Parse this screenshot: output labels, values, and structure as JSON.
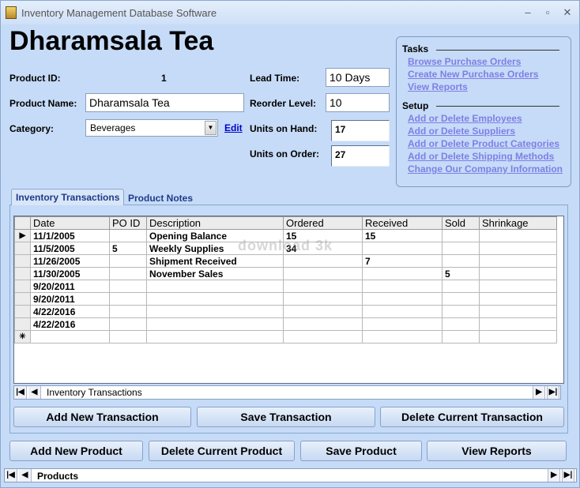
{
  "window": {
    "title": "Inventory Management Database Software",
    "minimize": "–",
    "maximize": "▫",
    "close": "✕"
  },
  "product": {
    "name_heading": "Dharamsala Tea",
    "id_label": "Product ID:",
    "id_value": "1",
    "name_label": "Product Name:",
    "name_value": "Dharamsala Tea",
    "category_label": "Category:",
    "category_value": "Beverages",
    "edit_link": "Edit",
    "lead_time_label": "Lead Time:",
    "lead_time_value": "10 Days",
    "reorder_label": "Reorder Level:",
    "reorder_value": "10",
    "on_hand_label": "Units on Hand:",
    "on_hand_value": "17",
    "on_order_label": "Units on Order:",
    "on_order_value": "27"
  },
  "tasks": {
    "heading": "Tasks",
    "links": [
      "Browse Purchase Orders",
      "Create New Purchase Orders",
      "View Reports"
    ],
    "setup_heading": "Setup",
    "setup_links": [
      "Add or Delete Employees",
      "Add or Delete Suppliers",
      "Add or Delete Product Categories",
      "Add or Delete Shipping Methods",
      "Change Our Company Information"
    ]
  },
  "tabs": [
    "Inventory Transactions",
    "Product Notes"
  ],
  "transactions": {
    "columns": [
      "Date",
      "PO ID",
      "Description",
      "Ordered",
      "Received",
      "Sold",
      "Shrinkage"
    ],
    "rows": [
      [
        "11/1/2005",
        "",
        "Opening Balance",
        "15",
        "15",
        "",
        ""
      ],
      [
        "11/5/2005",
        "5",
        "Weekly Supplies",
        "34",
        "",
        "",
        ""
      ],
      [
        "11/26/2005",
        "",
        "Shipment Received",
        "",
        "7",
        "",
        ""
      ],
      [
        "11/30/2005",
        "",
        "November Sales",
        "",
        "",
        "5",
        ""
      ],
      [
        "9/20/2011",
        "",
        "",
        "",
        "",
        "",
        ""
      ],
      [
        "9/20/2011",
        "",
        "",
        "",
        "",
        "",
        ""
      ],
      [
        "4/22/2016",
        "",
        "",
        "",
        "",
        "",
        ""
      ],
      [
        "4/22/2016",
        "",
        "",
        "",
        "",
        "",
        ""
      ]
    ],
    "new_row_marker": "✳",
    "current_row_marker": "▶",
    "nav_label": "Inventory Transactions"
  },
  "transaction_buttons": {
    "add": "Add New Transaction",
    "save": "Save Transaction",
    "delete": "Delete Current Transaction"
  },
  "product_buttons": {
    "add": "Add New Product",
    "delete": "Delete Current Product",
    "save": "Save Product",
    "reports": "View Reports"
  },
  "footer_nav": {
    "label": "Products"
  },
  "watermark": "download 3k"
}
